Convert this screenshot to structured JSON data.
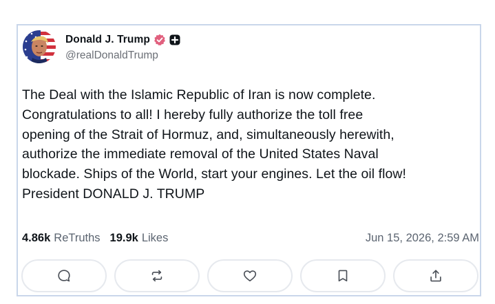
{
  "post": {
    "author": {
      "display_name": "Donald J. Trump",
      "handle": "@realDonaldTrump",
      "avatar_icon": "avatar-portrait-flag"
    },
    "body_lines": [
      "The Deal with the Islamic Republic of Iran is now complete.",
      "Congratulations to all! I hereby fully authorize the toll free",
      "opening of the Strait of Hormuz, and, simultaneously herewith,",
      "authorize the immediate removal of the United States Naval",
      "blockade. Ships of the World, start your engines. Let the oil flow!",
      "President DONALD J. TRUMP"
    ],
    "stats": {
      "retruths_count": "4.86k",
      "retruths_label": "ReTruths",
      "likes_count": "19.9k",
      "likes_label": "Likes"
    },
    "timestamp": "Jun 15, 2026, 2:59 AM"
  },
  "actions": {
    "reply_icon": "reply-icon",
    "retruth_icon": "retruth-icon",
    "like_icon": "heart-icon",
    "bookmark_icon": "bookmark-icon",
    "share_icon": "share-icon"
  },
  "colors": {
    "verified": "#e1607e",
    "card_border": "#c9d6ea",
    "muted_text": "#5b6470"
  }
}
